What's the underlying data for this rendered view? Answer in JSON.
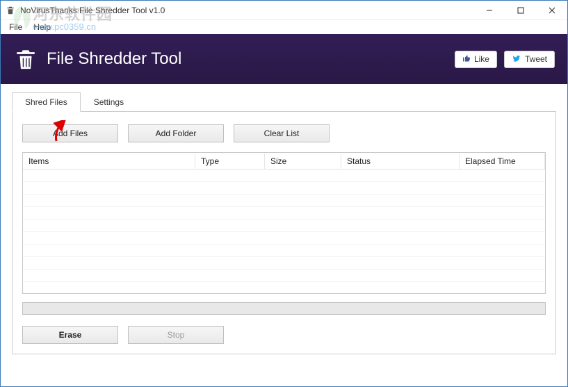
{
  "window": {
    "title": "NoVirusThanks File Shredder Tool v1.0"
  },
  "menu": {
    "file": "File",
    "help": "Help"
  },
  "banner": {
    "title": "File Shredder Tool",
    "like_label": "Like",
    "tweet_label": "Tweet"
  },
  "tabs": {
    "shred": "Shred Files",
    "settings": "Settings"
  },
  "toolbar": {
    "add_files": "Add Files",
    "add_folder": "Add Folder",
    "clear_list": "Clear List"
  },
  "columns": {
    "items": "Items",
    "type": "Type",
    "size": "Size",
    "status": "Status",
    "elapsed": "Elapsed Time"
  },
  "actions": {
    "erase": "Erase",
    "stop": "Stop"
  },
  "watermark": {
    "line1": "河东软件园",
    "line2": "www.pc0359.cn"
  }
}
